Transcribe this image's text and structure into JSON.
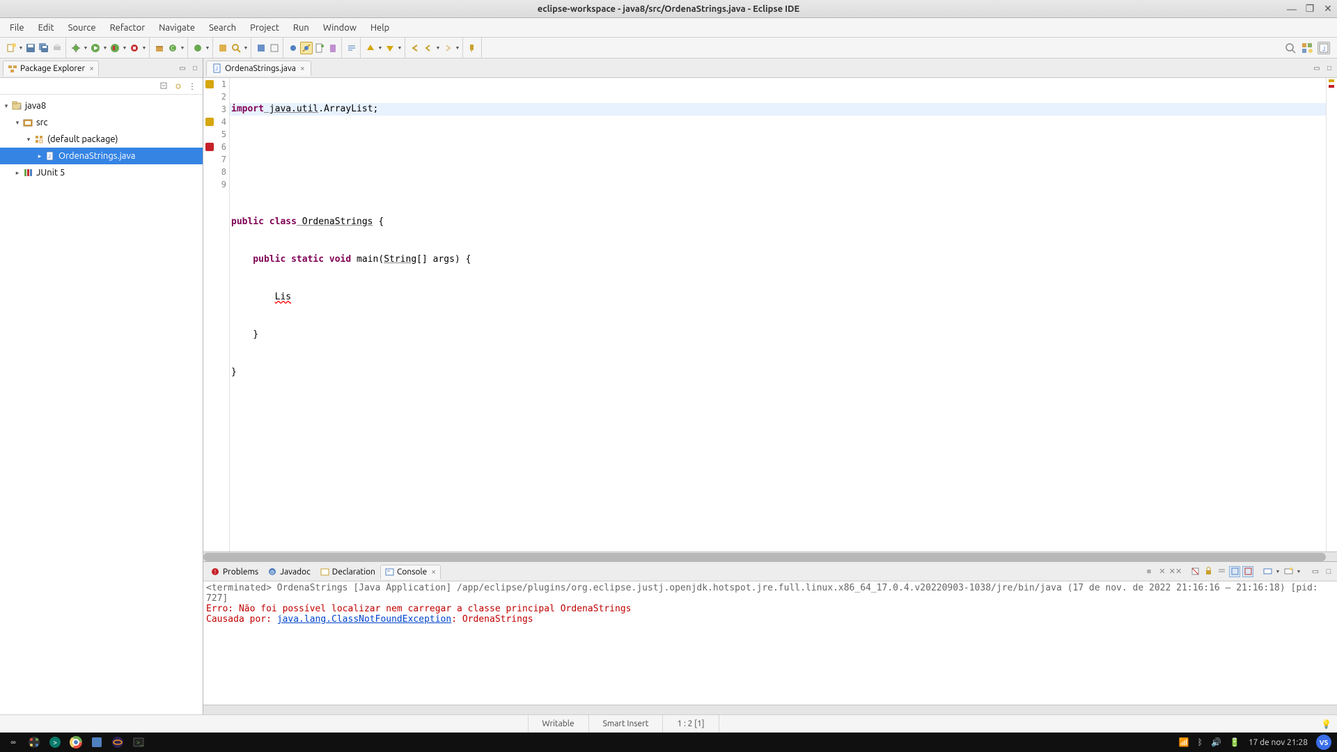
{
  "window": {
    "title": "eclipse-workspace - java8/src/OrdenaStrings.java - Eclipse IDE"
  },
  "menu": [
    "File",
    "Edit",
    "Source",
    "Refactor",
    "Navigate",
    "Search",
    "Project",
    "Run",
    "Window",
    "Help"
  ],
  "packageExplorer": {
    "title": "Package Explorer",
    "tree": {
      "project": "java8",
      "src": "src",
      "pkg": "(default package)",
      "file": "OrdenaStrings.java",
      "junit": "JUnit 5"
    }
  },
  "editor": {
    "tab": "OrdenaStrings.java",
    "lines": {
      "l1_import": "import",
      "l1_pkg": " java.util",
      "l1_rest": ".ArrayList;",
      "l4_a": "public",
      "l4_b": " class",
      "l4_c": " OrdenaStrings",
      "l4_d": " {",
      "l5_a": "    public",
      "l5_b": " static",
      "l5_c": " void",
      "l5_d": " main(",
      "l5_e": "String",
      "l5_f": "[] args) {",
      "l6_a": "        ",
      "l6_b": "Lis",
      "l7": "    }",
      "l8": "}"
    },
    "lineNumbers": [
      "1",
      "2",
      "3",
      "4",
      "5",
      "6",
      "7",
      "8",
      "9"
    ]
  },
  "bottom": {
    "tabs": {
      "problems": "Problems",
      "javadoc": "Javadoc",
      "declaration": "Declaration",
      "console": "Console"
    },
    "consoleHeader": "<terminated> OrdenaStrings [Java Application] /app/eclipse/plugins/org.eclipse.justj.openjdk.hotspot.jre.full.linux.x86_64_17.0.4.v20220903-1038/jre/bin/java  (17 de nov. de 2022 21:16:16 – 21:16:18) [pid: 727]",
    "consoleErr1": "Erro: Não foi possível localizar nem carregar a classe principal OrdenaStrings",
    "consoleErr2a": "Causada por: ",
    "consoleErr2link": "java.lang.ClassNotFoundException",
    "consoleErr2b": ": OrdenaStrings"
  },
  "status": {
    "writable": "Writable",
    "insert": "Smart Insert",
    "pos": "1 : 2 [1]"
  },
  "taskbar": {
    "clock": "17 de nov  21:28",
    "user": "VS"
  }
}
